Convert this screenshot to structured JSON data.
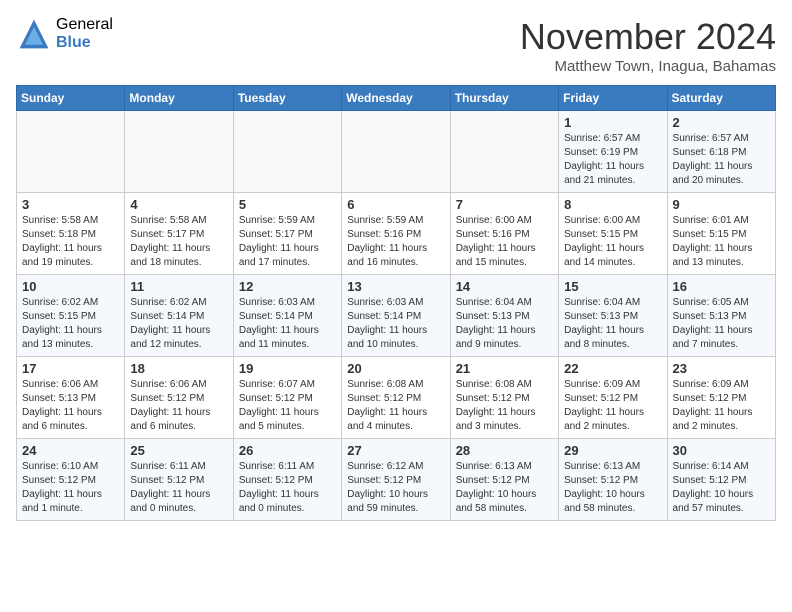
{
  "header": {
    "logo_general": "General",
    "logo_blue": "Blue",
    "title": "November 2024",
    "subtitle": "Matthew Town, Inagua, Bahamas"
  },
  "weekdays": [
    "Sunday",
    "Monday",
    "Tuesday",
    "Wednesday",
    "Thursday",
    "Friday",
    "Saturday"
  ],
  "weeks": [
    [
      {
        "day": "",
        "info": ""
      },
      {
        "day": "",
        "info": ""
      },
      {
        "day": "",
        "info": ""
      },
      {
        "day": "",
        "info": ""
      },
      {
        "day": "",
        "info": ""
      },
      {
        "day": "1",
        "info": "Sunrise: 6:57 AM\nSunset: 6:19 PM\nDaylight: 11 hours\nand 21 minutes."
      },
      {
        "day": "2",
        "info": "Sunrise: 6:57 AM\nSunset: 6:18 PM\nDaylight: 11 hours\nand 20 minutes."
      }
    ],
    [
      {
        "day": "3",
        "info": "Sunrise: 5:58 AM\nSunset: 5:18 PM\nDaylight: 11 hours\nand 19 minutes."
      },
      {
        "day": "4",
        "info": "Sunrise: 5:58 AM\nSunset: 5:17 PM\nDaylight: 11 hours\nand 18 minutes."
      },
      {
        "day": "5",
        "info": "Sunrise: 5:59 AM\nSunset: 5:17 PM\nDaylight: 11 hours\nand 17 minutes."
      },
      {
        "day": "6",
        "info": "Sunrise: 5:59 AM\nSunset: 5:16 PM\nDaylight: 11 hours\nand 16 minutes."
      },
      {
        "day": "7",
        "info": "Sunrise: 6:00 AM\nSunset: 5:16 PM\nDaylight: 11 hours\nand 15 minutes."
      },
      {
        "day": "8",
        "info": "Sunrise: 6:00 AM\nSunset: 5:15 PM\nDaylight: 11 hours\nand 14 minutes."
      },
      {
        "day": "9",
        "info": "Sunrise: 6:01 AM\nSunset: 5:15 PM\nDaylight: 11 hours\nand 13 minutes."
      }
    ],
    [
      {
        "day": "10",
        "info": "Sunrise: 6:02 AM\nSunset: 5:15 PM\nDaylight: 11 hours\nand 13 minutes."
      },
      {
        "day": "11",
        "info": "Sunrise: 6:02 AM\nSunset: 5:14 PM\nDaylight: 11 hours\nand 12 minutes."
      },
      {
        "day": "12",
        "info": "Sunrise: 6:03 AM\nSunset: 5:14 PM\nDaylight: 11 hours\nand 11 minutes."
      },
      {
        "day": "13",
        "info": "Sunrise: 6:03 AM\nSunset: 5:14 PM\nDaylight: 11 hours\nand 10 minutes."
      },
      {
        "day": "14",
        "info": "Sunrise: 6:04 AM\nSunset: 5:13 PM\nDaylight: 11 hours\nand 9 minutes."
      },
      {
        "day": "15",
        "info": "Sunrise: 6:04 AM\nSunset: 5:13 PM\nDaylight: 11 hours\nand 8 minutes."
      },
      {
        "day": "16",
        "info": "Sunrise: 6:05 AM\nSunset: 5:13 PM\nDaylight: 11 hours\nand 7 minutes."
      }
    ],
    [
      {
        "day": "17",
        "info": "Sunrise: 6:06 AM\nSunset: 5:13 PM\nDaylight: 11 hours\nand 6 minutes."
      },
      {
        "day": "18",
        "info": "Sunrise: 6:06 AM\nSunset: 5:12 PM\nDaylight: 11 hours\nand 6 minutes."
      },
      {
        "day": "19",
        "info": "Sunrise: 6:07 AM\nSunset: 5:12 PM\nDaylight: 11 hours\nand 5 minutes."
      },
      {
        "day": "20",
        "info": "Sunrise: 6:08 AM\nSunset: 5:12 PM\nDaylight: 11 hours\nand 4 minutes."
      },
      {
        "day": "21",
        "info": "Sunrise: 6:08 AM\nSunset: 5:12 PM\nDaylight: 11 hours\nand 3 minutes."
      },
      {
        "day": "22",
        "info": "Sunrise: 6:09 AM\nSunset: 5:12 PM\nDaylight: 11 hours\nand 2 minutes."
      },
      {
        "day": "23",
        "info": "Sunrise: 6:09 AM\nSunset: 5:12 PM\nDaylight: 11 hours\nand 2 minutes."
      }
    ],
    [
      {
        "day": "24",
        "info": "Sunrise: 6:10 AM\nSunset: 5:12 PM\nDaylight: 11 hours\nand 1 minute."
      },
      {
        "day": "25",
        "info": "Sunrise: 6:11 AM\nSunset: 5:12 PM\nDaylight: 11 hours\nand 0 minutes."
      },
      {
        "day": "26",
        "info": "Sunrise: 6:11 AM\nSunset: 5:12 PM\nDaylight: 11 hours\nand 0 minutes."
      },
      {
        "day": "27",
        "info": "Sunrise: 6:12 AM\nSunset: 5:12 PM\nDaylight: 10 hours\nand 59 minutes."
      },
      {
        "day": "28",
        "info": "Sunrise: 6:13 AM\nSunset: 5:12 PM\nDaylight: 10 hours\nand 58 minutes."
      },
      {
        "day": "29",
        "info": "Sunrise: 6:13 AM\nSunset: 5:12 PM\nDaylight: 10 hours\nand 58 minutes."
      },
      {
        "day": "30",
        "info": "Sunrise: 6:14 AM\nSunset: 5:12 PM\nDaylight: 10 hours\nand 57 minutes."
      }
    ]
  ]
}
